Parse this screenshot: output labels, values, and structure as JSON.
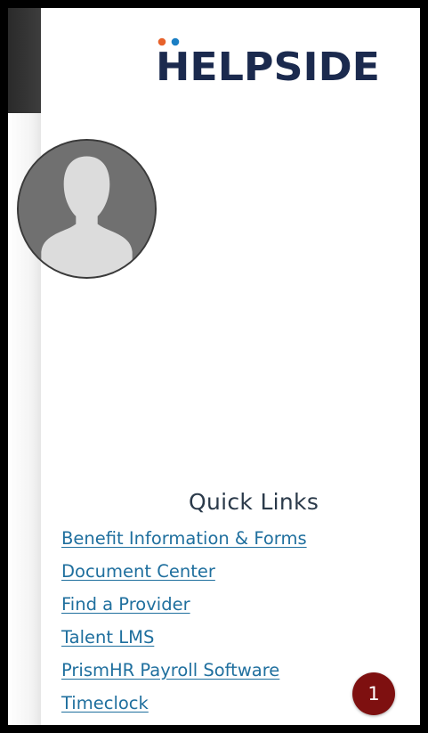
{
  "brand": {
    "logo_text": "HELPSIDE",
    "colors": {
      "navy": "#1b2a4e",
      "dot_orange": "#e7622b",
      "dot_blue": "#1b7fc4"
    }
  },
  "profile": {
    "avatar_icon": "user-silhouette-icon"
  },
  "quick_links": {
    "title": "Quick Links",
    "items": [
      {
        "label": "Benefit Information & Forms"
      },
      {
        "label": "Document Center"
      },
      {
        "label": "Find a Provider"
      },
      {
        "label": "Talent LMS"
      },
      {
        "label": "PrismHR Payroll Software"
      },
      {
        "label": "Timeclock"
      }
    ]
  },
  "notification_badge": {
    "count": "1",
    "color": "#7e1010"
  }
}
